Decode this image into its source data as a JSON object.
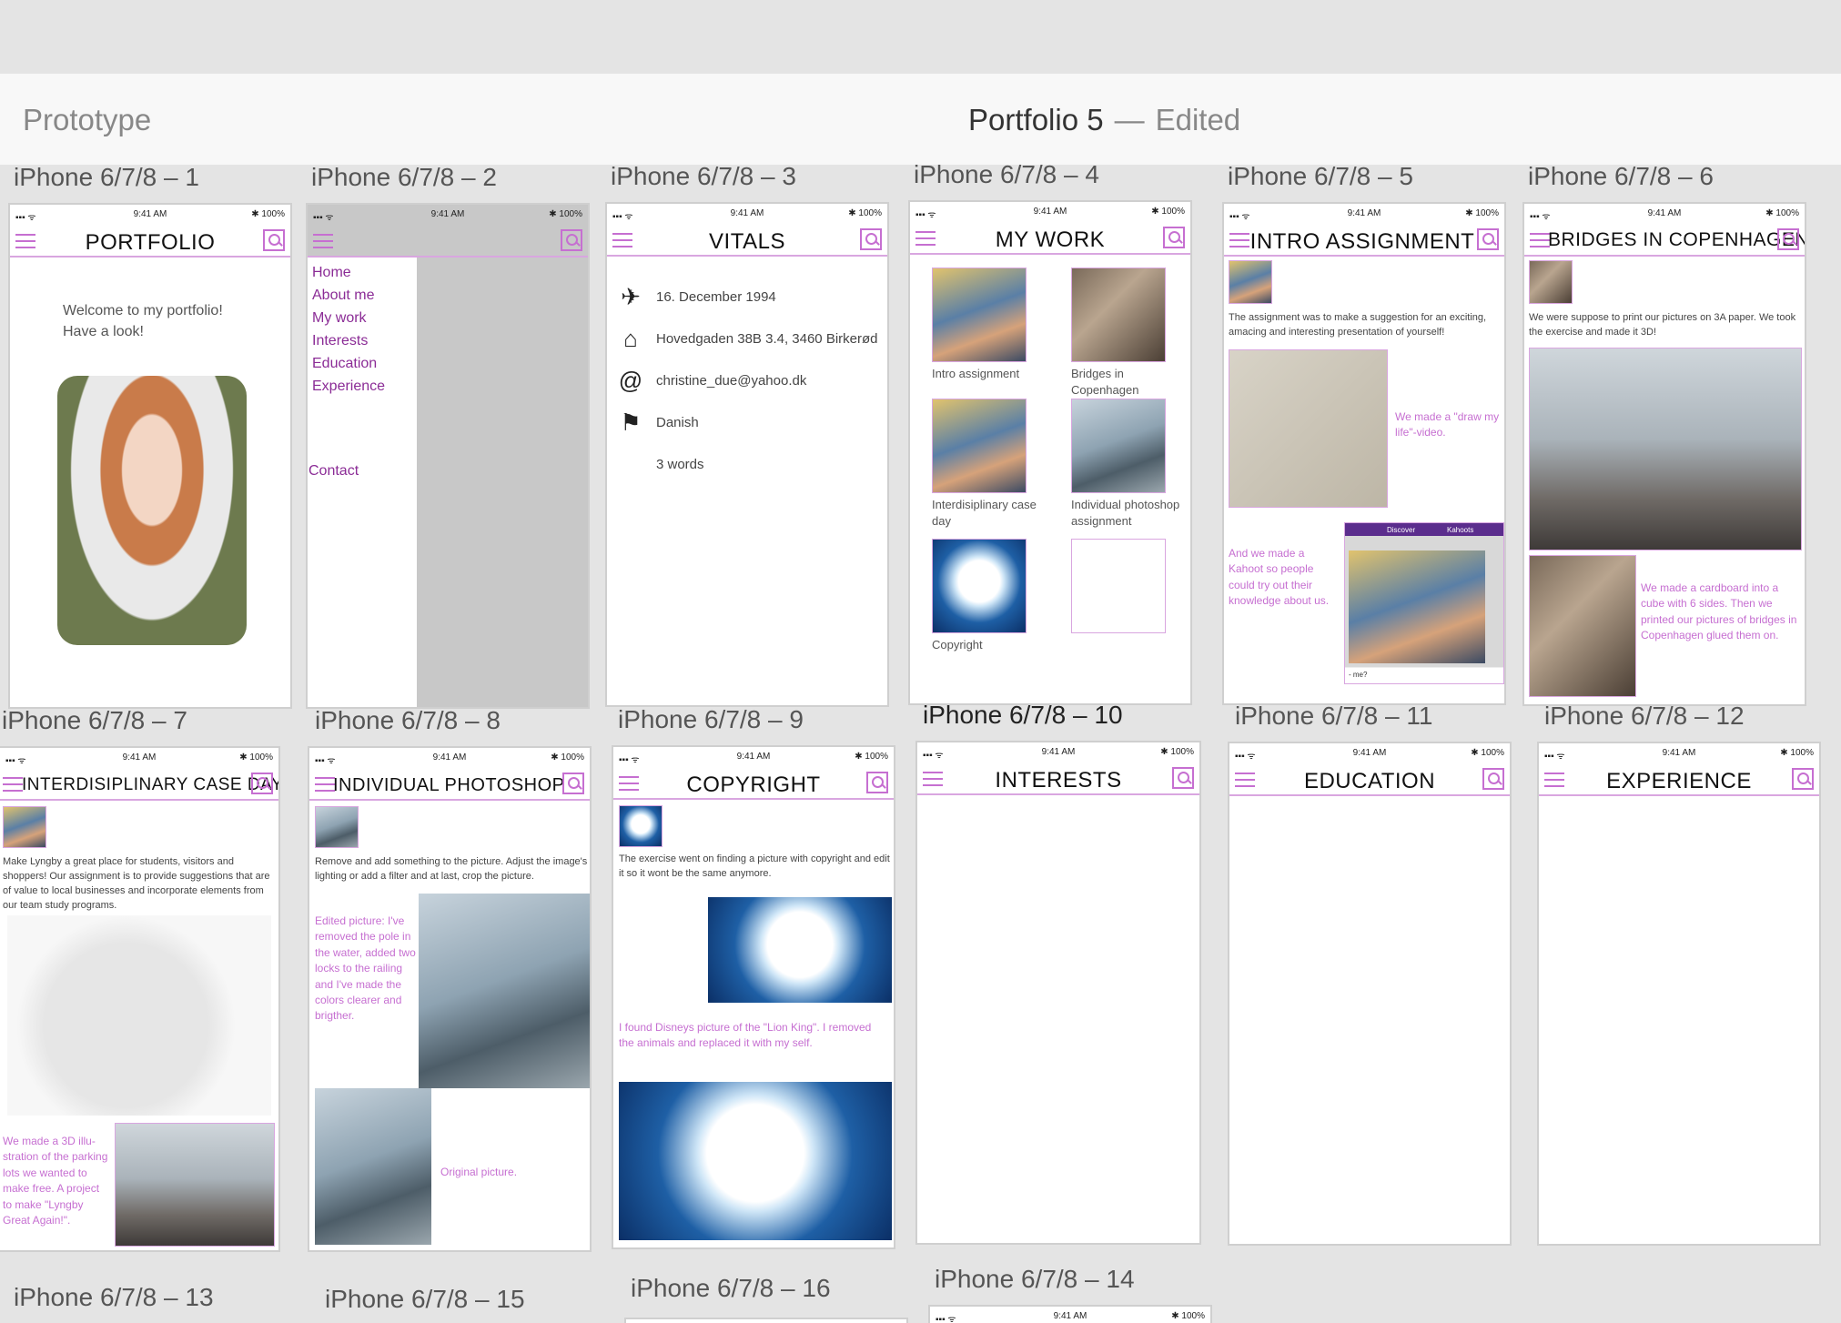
{
  "app": {
    "mode": "Prototype",
    "document_name": "Portfolio 5",
    "separator": "—",
    "status": "Edited"
  },
  "status_bar": {
    "time": "9:41 AM",
    "battery": "100%",
    "signal": "▪▪▪ ᯤ",
    "bt": "✱"
  },
  "artboards": {
    "a1": "iPhone 6/7/8 – 1",
    "a2": "iPhone 6/7/8 – 2",
    "a3": "iPhone 6/7/8 – 3",
    "a4": "iPhone 6/7/8 – 4",
    "a5": "iPhone 6/7/8 – 5",
    "a6": "iPhone 6/7/8 – 6",
    "a7": "iPhone 6/7/8 – 7",
    "a8": "iPhone 6/7/8 – 8",
    "a9": "iPhone 6/7/8 – 9",
    "a10": "iPhone 6/7/8 – 10",
    "a11": "iPhone 6/7/8 – 11",
    "a12": "iPhone 6/7/8 – 12",
    "a13": "iPhone 6/7/8 – 13",
    "a15": "iPhone 6/7/8 – 15",
    "a16": "iPhone 6/7/8 – 16",
    "a14": "iPhone 6/7/8 – 14"
  },
  "portfolio": {
    "title": "PORTFOLIO",
    "welcome": "Welcome to my portfolio!",
    "look": "Have a look!"
  },
  "menu": {
    "items": [
      "Home",
      "About me",
      "My work",
      "Interests",
      "Education",
      "Experience"
    ],
    "contact": "Contact"
  },
  "vitals": {
    "title": "VITALS",
    "birthday": "16. December 1994",
    "address": "Hovedgaden 38B 3.4, 3460 Birkerød",
    "email": "christine_due@yahoo.dk",
    "nationality": "Danish",
    "words": "3 words"
  },
  "my_work": {
    "title": "MY WORK",
    "items": [
      "Intro assignment",
      "Bridges in Copenhagen",
      "Interdisiplinary case day",
      "Individual photoshop assignment",
      "Copyright"
    ]
  },
  "intro": {
    "title": "INTRO ASSIGNMENT",
    "desc": "The assignment was to make a suggestion for an exciting, amacing and interesting presentation of yourself!",
    "video_note": "We made a \"draw my life\"-video.",
    "kahoot_note": "And we made a Kahoot so people could try out their knowledge about us.",
    "kahoot_tab1": "Discover",
    "kahoot_tab2": "Kahoots",
    "kahoot_q": "- me?"
  },
  "bridges": {
    "title": "BRIDGES IN COPENHAGEN",
    "desc": "We were suppose to print our pictures on 3A paper. We took the exercise and made it 3D!",
    "note": "We made a cardboard into a cube with 6 sides. Then we printed our pictures of bridges in Copenhagen glued them on."
  },
  "case_day": {
    "title": "INTERDISIPLINARY CASE DAY",
    "desc": "Make Lyngby a great place for students, visitors and shoppers! Our assignment is to provide suggestions that are of value to local businesses and incorporate elements from our team study programs.",
    "note": "We made a 3D illu-stration of the parking lots we wanted to make free. A project to make \"Lyngby Great Again!\"."
  },
  "photoshop": {
    "title": "INDIVIDUAL PHOTOSHOP",
    "desc": "Remove and add something to the picture. Adjust the image's lighting or add a filter and at last, crop the picture.",
    "edited": "Edited picture: I've removed the pole in the water, added two locks to the railing and I've made the colors clearer and brigther.",
    "original": "Original picture."
  },
  "copyright": {
    "title": "COPYRIGHT",
    "desc": "The exercise went on finding a picture with copyright and edit it so it wont be the same anymore.",
    "note": "I found Disneys picture of the \"Lion King\". I removed the animals and replaced it with my self."
  },
  "interests": {
    "title": "INTERESTS"
  },
  "education": {
    "title": "EDUCATION"
  },
  "experience": {
    "title": "EXPERIENCE"
  }
}
